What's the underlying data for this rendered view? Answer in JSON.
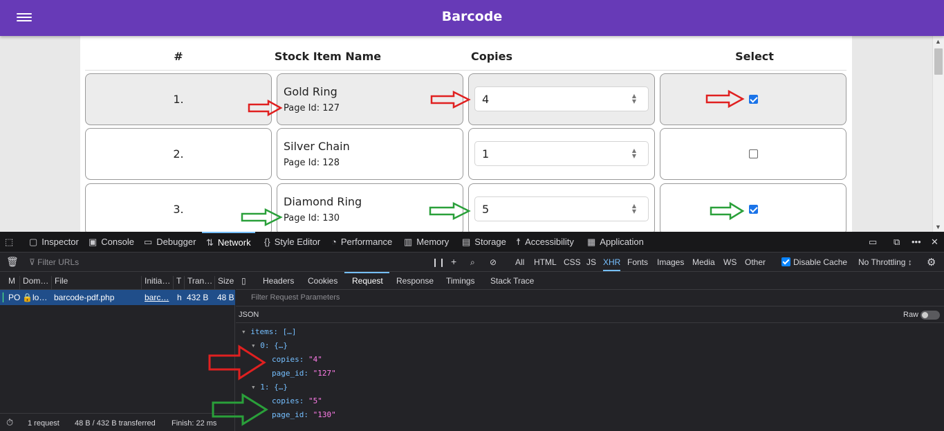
{
  "app": {
    "title": "Barcode"
  },
  "table": {
    "headers": [
      "#",
      "Stock Item Name",
      "Copies",
      "Select"
    ],
    "rows": [
      {
        "num": "1.",
        "name": "Gold Ring",
        "page_id": "Page Id: 127",
        "copies": "4",
        "checked": true
      },
      {
        "num": "2.",
        "name": "Silver Chain",
        "page_id": "Page Id: 128",
        "copies": "1",
        "checked": false
      },
      {
        "num": "3.",
        "name": "Diamond Ring",
        "page_id": "Page Id: 130",
        "copies": "5",
        "checked": true
      }
    ]
  },
  "devtools": {
    "tabs": [
      "Inspector",
      "Console",
      "Debugger",
      "Network",
      "Style Editor",
      "Performance",
      "Memory",
      "Storage",
      "Accessibility",
      "Application"
    ],
    "active_tab": "Network",
    "filter_urls_placeholder": "Filter URLs",
    "type_filters": [
      "All",
      "HTML",
      "CSS",
      "JS",
      "XHR",
      "Fonts",
      "Images",
      "Media",
      "WS",
      "Other"
    ],
    "active_type": "XHR",
    "disable_cache_label": "Disable Cache",
    "throttling": "No Throttling ↕",
    "columns": [
      "M",
      "Dom…",
      "File",
      "Initia…",
      "T",
      "Tran…",
      "Size"
    ],
    "request": {
      "method": "PO",
      "domain": "lo…",
      "file": "barcode-pdf.php",
      "initiator": "barc…",
      "type": "h",
      "transferred": "432 B",
      "size": "48 B"
    },
    "status": {
      "requests": "1 request",
      "transferred": "48 B / 432 B transferred",
      "finish": "Finish: 22 ms"
    },
    "detail_tabs": [
      "Headers",
      "Cookies",
      "Request",
      "Response",
      "Timings",
      "Stack Trace"
    ],
    "active_detail_tab": "Request",
    "filter_params_placeholder": "Filter Request Parameters",
    "json_label": "JSON",
    "raw_label": "Raw",
    "json": {
      "items_line": "items: […]",
      "item0": "0: {…}",
      "item0_copies_key": "copies:",
      "item0_copies_val": "\"4\"",
      "item0_pid_key": "page_id:",
      "item0_pid_val": "\"127\"",
      "item1": "1: {…}",
      "item1_copies_key": "copies:",
      "item1_copies_val": "\"5\"",
      "item1_pid_key": "page_id:",
      "item1_pid_val": "\"130\""
    }
  },
  "colors": {
    "appbar": "#673ab7",
    "red_arrow": "#e02020",
    "green_arrow": "#2aa03a",
    "checkbox": "#1a73e8"
  }
}
